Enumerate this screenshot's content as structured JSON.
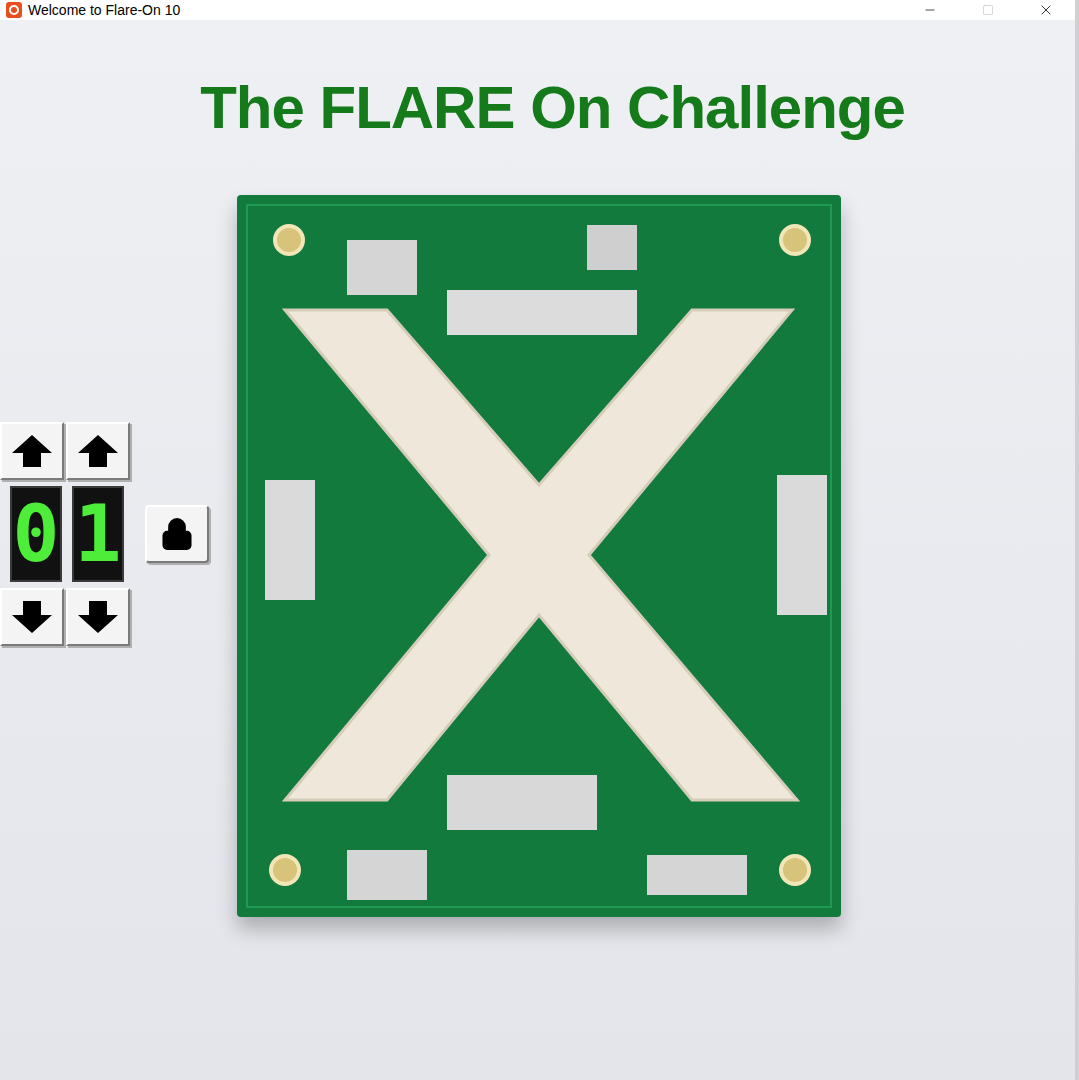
{
  "window": {
    "title": "Welcome to Flare-On 10"
  },
  "heading": "The FLARE On Challenge",
  "counter": {
    "digits": [
      "0",
      "1"
    ]
  },
  "lock": {
    "locked": true
  }
}
